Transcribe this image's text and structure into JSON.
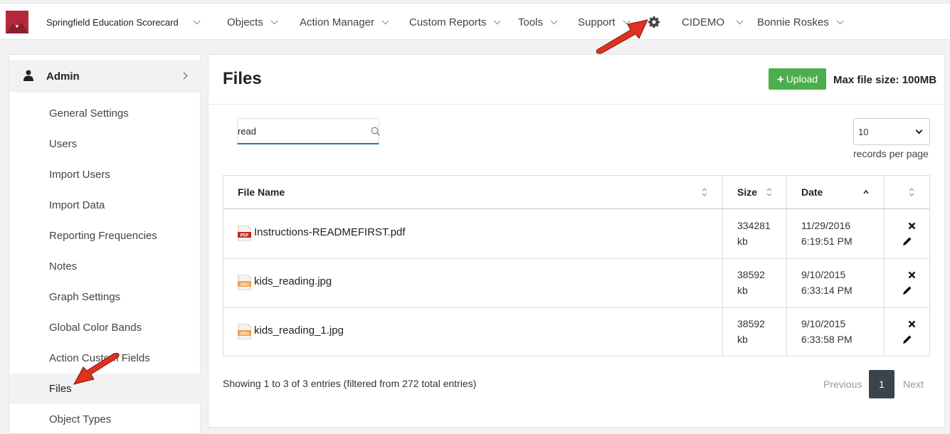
{
  "nav": {
    "brand": "Springfield Education Scorecard",
    "items": [
      "Objects",
      "Action Manager",
      "Custom Reports",
      "Tools",
      "Support"
    ],
    "org": "CIDEMO",
    "user": "Bonnie Roskes",
    "icons": {
      "settings": "gear-icon",
      "logo": "bookmark-logo"
    },
    "logo_color": "#b52a3a"
  },
  "sidebar": {
    "section": "Admin",
    "items": [
      {
        "label": "General Settings"
      },
      {
        "label": "Users"
      },
      {
        "label": "Import Users"
      },
      {
        "label": "Import Data"
      },
      {
        "label": "Reporting Frequencies"
      },
      {
        "label": "Notes"
      },
      {
        "label": "Graph Settings"
      },
      {
        "label": "Global Color Bands"
      },
      {
        "label": "Action Custom Fields"
      },
      {
        "label": "Files"
      },
      {
        "label": "Object Types"
      }
    ],
    "active": "Files"
  },
  "main": {
    "title": "Files",
    "upload_label": "Upload",
    "max_size": "Max file size: 100MB",
    "search_value": "read",
    "rpp_value": "10",
    "rpp_label": "records per page",
    "columns": [
      "File Name",
      "Size",
      "Date"
    ],
    "rows": [
      {
        "name": "Instructions-READMEFIRST.pdf",
        "type": "PDF",
        "size1": "334281",
        "size2": "kb",
        "date1": "11/29/2016",
        "date2": "6:19:51 PM"
      },
      {
        "name": "kids_reading.jpg",
        "type": "JPEG",
        "size1": "38592",
        "size2": "kb",
        "date1": "9/10/2015",
        "date2": "6:33:14 PM"
      },
      {
        "name": "kids_reading_1.jpg",
        "type": "JPEG",
        "size1": "38592",
        "size2": "kb",
        "date1": "9/10/2015",
        "date2": "6:33:58 PM"
      }
    ],
    "showing": "Showing 1 to 3 of 3 entries (filtered from 272 total entries)",
    "pagination": {
      "prev": "Previous",
      "current": "1",
      "next": "Next"
    },
    "colors": {
      "upload": "#4cae4c",
      "active_page": "#3a444d",
      "search_underline": "#2a7ab0",
      "annotation_arrow": "#e0301e"
    }
  }
}
